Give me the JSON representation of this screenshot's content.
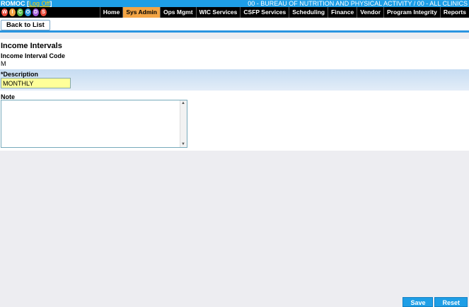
{
  "header": {
    "user": "ROMOC",
    "logoff": "Log Off",
    "organization": "00 - BUREAU OF NUTRITION AND PHYSICAL ACTIVITY / 00 - ALL CLINICS"
  },
  "logo": {
    "letters": [
      "W",
      "I",
      "C",
      "O",
      "D",
      "S"
    ],
    "colors": [
      "#e94b3c",
      "#f3a545",
      "#5bbd4a",
      "#2a95e0",
      "#a05bd6",
      "#e94b3c"
    ]
  },
  "nav": {
    "items": [
      "Home",
      "Sys Admin",
      "Ops Mgmt",
      "WIC Services",
      "CSFP Services",
      "Scheduling",
      "Finance",
      "Vendor",
      "Program Integrity",
      "Reports"
    ],
    "active": "Sys Admin"
  },
  "toolbar": {
    "back_label": "Back to List"
  },
  "form": {
    "title": "Income Intervals",
    "code_label": "Income Interval Code",
    "code_value": "M",
    "description_label": "*Description",
    "description_value": "MONTHLY",
    "note_label": "Note",
    "note_value": ""
  },
  "actions": {
    "save_label": "Save",
    "reset_label": "Reset"
  }
}
